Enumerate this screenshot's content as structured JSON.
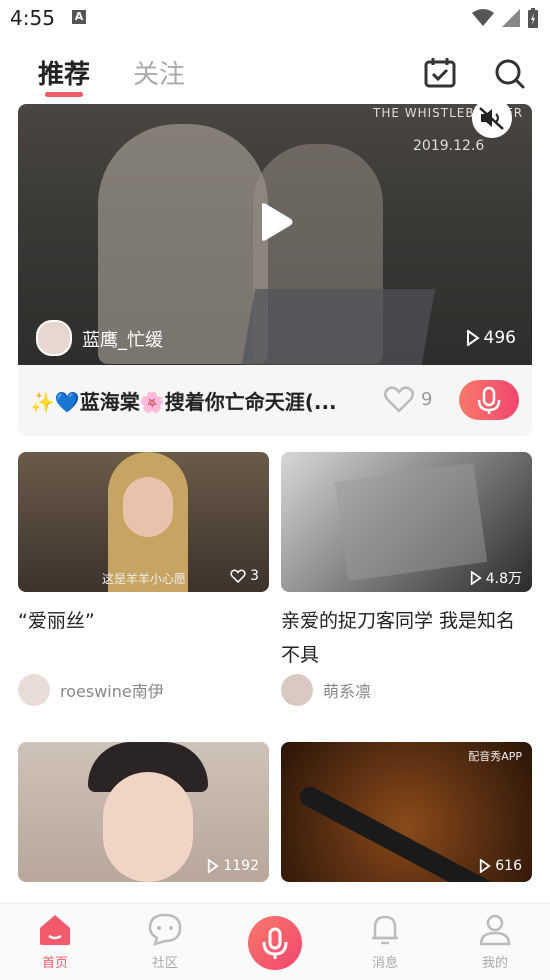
{
  "status": {
    "time": "4:55",
    "indicator": "A"
  },
  "top_tabs": [
    {
      "label": "推荐",
      "active": true
    },
    {
      "label": "关注",
      "active": false
    }
  ],
  "header_icons": [
    "calendar-check-icon",
    "search-icon"
  ],
  "featured": {
    "poster_title": "THE WHISTLEBLOWER",
    "poster_date": "2019.12.6",
    "author": "蓝鹰_忙缓",
    "views": "496",
    "title": "✨💙蓝海棠🌸搜着你亡命天涯(...",
    "likes": "9"
  },
  "cards": [
    {
      "thumb_caption": "这是羊羊小心愿",
      "stat": "3",
      "stat_icon": "heart-icon",
      "title": "“爱丽丝”",
      "user": "roeswine南伊"
    },
    {
      "stat": "4.8万",
      "stat_icon": "play-icon",
      "title": "亲爱的捉刀客同学 我是知名不具",
      "user": "萌系凛"
    },
    {
      "stat": "1192",
      "stat_icon": "play-icon",
      "title": "",
      "user": ""
    },
    {
      "thumb_caption": "配音秀APP",
      "stat": "616",
      "stat_icon": "play-icon",
      "title": "",
      "user": ""
    }
  ],
  "bottom_nav": [
    {
      "label": "首页",
      "icon": "home-icon",
      "active": true
    },
    {
      "label": "社区",
      "icon": "chat-bubble-icon",
      "active": false
    },
    {
      "label": "",
      "icon": "mic-icon",
      "active": false
    },
    {
      "label": "消息",
      "icon": "bell-icon",
      "active": false
    },
    {
      "label": "我的",
      "icon": "profile-icon",
      "active": false
    }
  ],
  "colors": {
    "accent": "#f25a6b",
    "muted": "#aaaaaa"
  }
}
